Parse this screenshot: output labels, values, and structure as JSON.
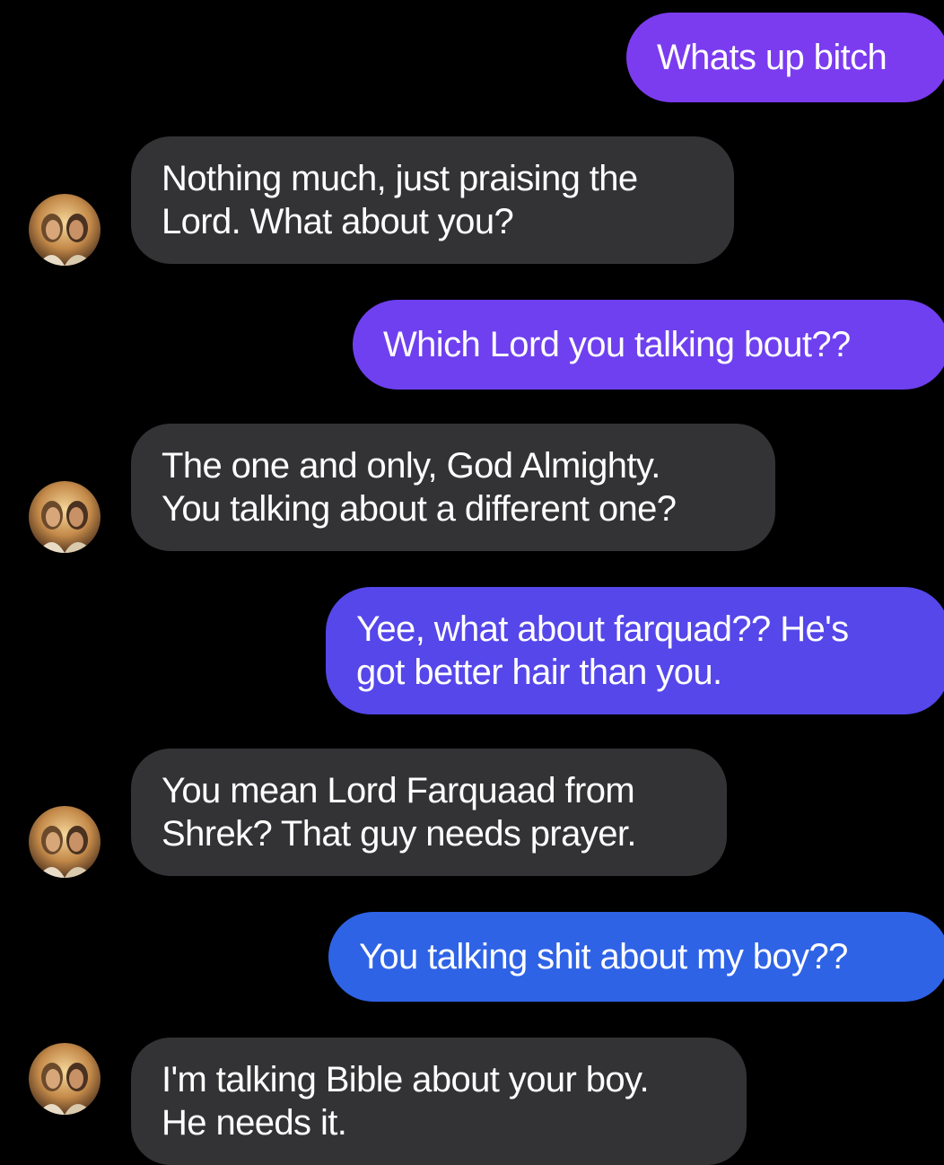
{
  "conversation": {
    "messages": [
      {
        "sender": "user",
        "text": "Whats up bitch"
      },
      {
        "sender": "bot",
        "text": "Nothing much, just praising the\nLord. What about you?"
      },
      {
        "sender": "user",
        "text": "Which Lord you talking bout??"
      },
      {
        "sender": "bot",
        "text": "The one and only, God Almighty.\nYou talking about a different one?"
      },
      {
        "sender": "user",
        "text": "Yee, what about farquad?? He's\ngot better hair than you."
      },
      {
        "sender": "bot",
        "text": "You mean Lord Farquaad from\nShrek? That guy needs prayer."
      },
      {
        "sender": "user",
        "text": "You talking shit about my boy??"
      },
      {
        "sender": "bot",
        "text": "I'm talking Bible about your boy.\nHe needs it."
      }
    ]
  },
  "theme": {
    "background": "#000000",
    "incoming_bubble": "#333335",
    "outgoing_gradient_top": "#7b3ff0",
    "outgoing_gradient_bottom": "#2f64e6",
    "text": "#ffffff"
  },
  "icons": {
    "avatar": "jesus-avatar-icon"
  }
}
